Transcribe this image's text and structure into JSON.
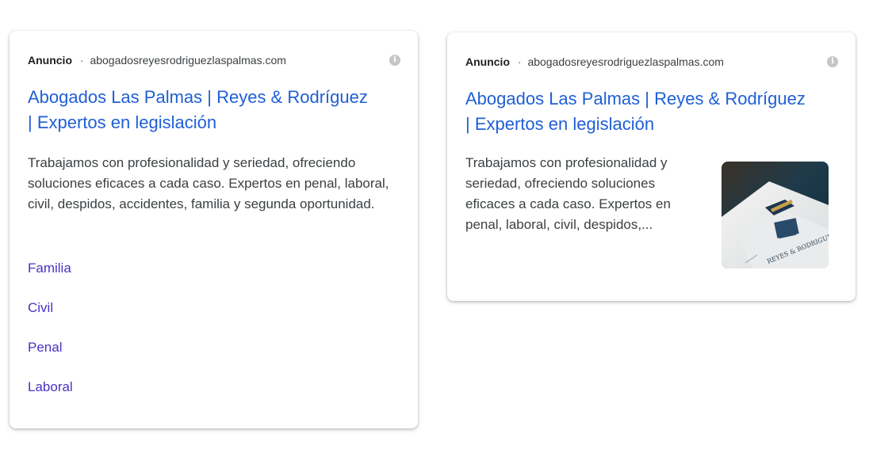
{
  "ads": [
    {
      "label": "Anuncio",
      "separator": "·",
      "url": "abogadosreyesrodriguezlaspalmas.com",
      "title": "Abogados Las Palmas | Reyes & Rodríguez | Expertos en legislación",
      "description": "Trabajamos con profesionalidad y seriedad, ofreciendo soluciones eficaces a cada caso. Expertos en penal, laboral, civil, despidos, accidentes, familia y segunda oportunidad.",
      "sitelinks": [
        "Familia",
        "Civil",
        "Penal",
        "Laboral"
      ]
    },
    {
      "label": "Anuncio",
      "separator": "·",
      "url": "abogadosreyesrodriguezlaspalmas.com",
      "title": "Abogados Las Palmas | Reyes & Rodríguez | Expertos en legislación",
      "description": "Trabajamos con profesionalidad y seriedad, ofreciendo soluciones eficaces a cada caso. Expertos en penal, laboral, civil, despidos,...",
      "thumbnail_text": "REYES & RODRIGUEZ"
    }
  ],
  "colors": {
    "title_link": "#1f5fd6",
    "sitelink": "#4b32c3",
    "text": "#3c4043",
    "info_icon": "#c4c7c5"
  },
  "icons": [
    "info-icon"
  ]
}
